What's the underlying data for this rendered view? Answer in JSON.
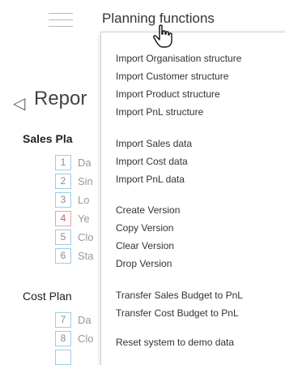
{
  "header": {
    "title": "Planning functions"
  },
  "icons": {
    "menu": "hamburger-icon",
    "back": "chevron-left-icon",
    "cursor": "hand-pointer-icon"
  },
  "colors": {
    "step_border": "#9ecbe2",
    "step_highlight_border": "#e6a2a8"
  },
  "page": {
    "back_glyph": "◁",
    "title": "Repor"
  },
  "sales_group": {
    "label": "Sales Pla",
    "steps": [
      {
        "num": "1",
        "label": "Da"
      },
      {
        "num": "2",
        "label": "Sin"
      },
      {
        "num": "3",
        "label": "Lo"
      },
      {
        "num": "4",
        "label": "Ye"
      },
      {
        "num": "5",
        "label": "Clo"
      },
      {
        "num": "6",
        "label": "Sta"
      }
    ]
  },
  "cost_group": {
    "label": "Cost Plan",
    "steps": [
      {
        "num": "7",
        "label": "Da"
      },
      {
        "num": "8",
        "label": "Clo"
      }
    ]
  },
  "menu": {
    "items": [
      "Import Organisation structure",
      "Import Customer structure",
      "Import Product structure",
      "Import PnL structure",
      "Import Sales data",
      "Import Cost data",
      "Import PnL data",
      "Create Version",
      "Copy Version",
      "Clear Version",
      "Drop Version",
      "Transfer Sales Budget to PnL",
      "Transfer Cost Budget to PnL",
      "Reset system to demo data"
    ]
  }
}
